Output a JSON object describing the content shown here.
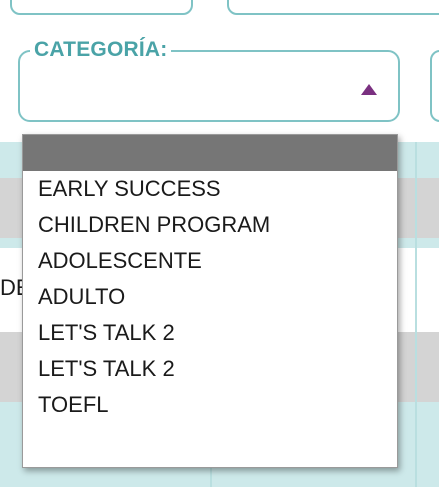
{
  "category_select": {
    "label": "CATEGORÍA:",
    "selected": "",
    "caret": "caret-up-icon",
    "label_color": "#4aa3a7",
    "border_color": "#7fc3c5",
    "caret_color": "#7a3080"
  },
  "dropdown": {
    "options": [
      "",
      "EARLY SUCCESS",
      "CHILDREN PROGRAM",
      "ADOLESCENTE",
      "ADULTO",
      "LET'S TALK 2",
      "LET'S TALK 2",
      "TOEFL"
    ],
    "highlight_color": "#767676"
  },
  "background": {
    "row_fragment": "DE"
  }
}
